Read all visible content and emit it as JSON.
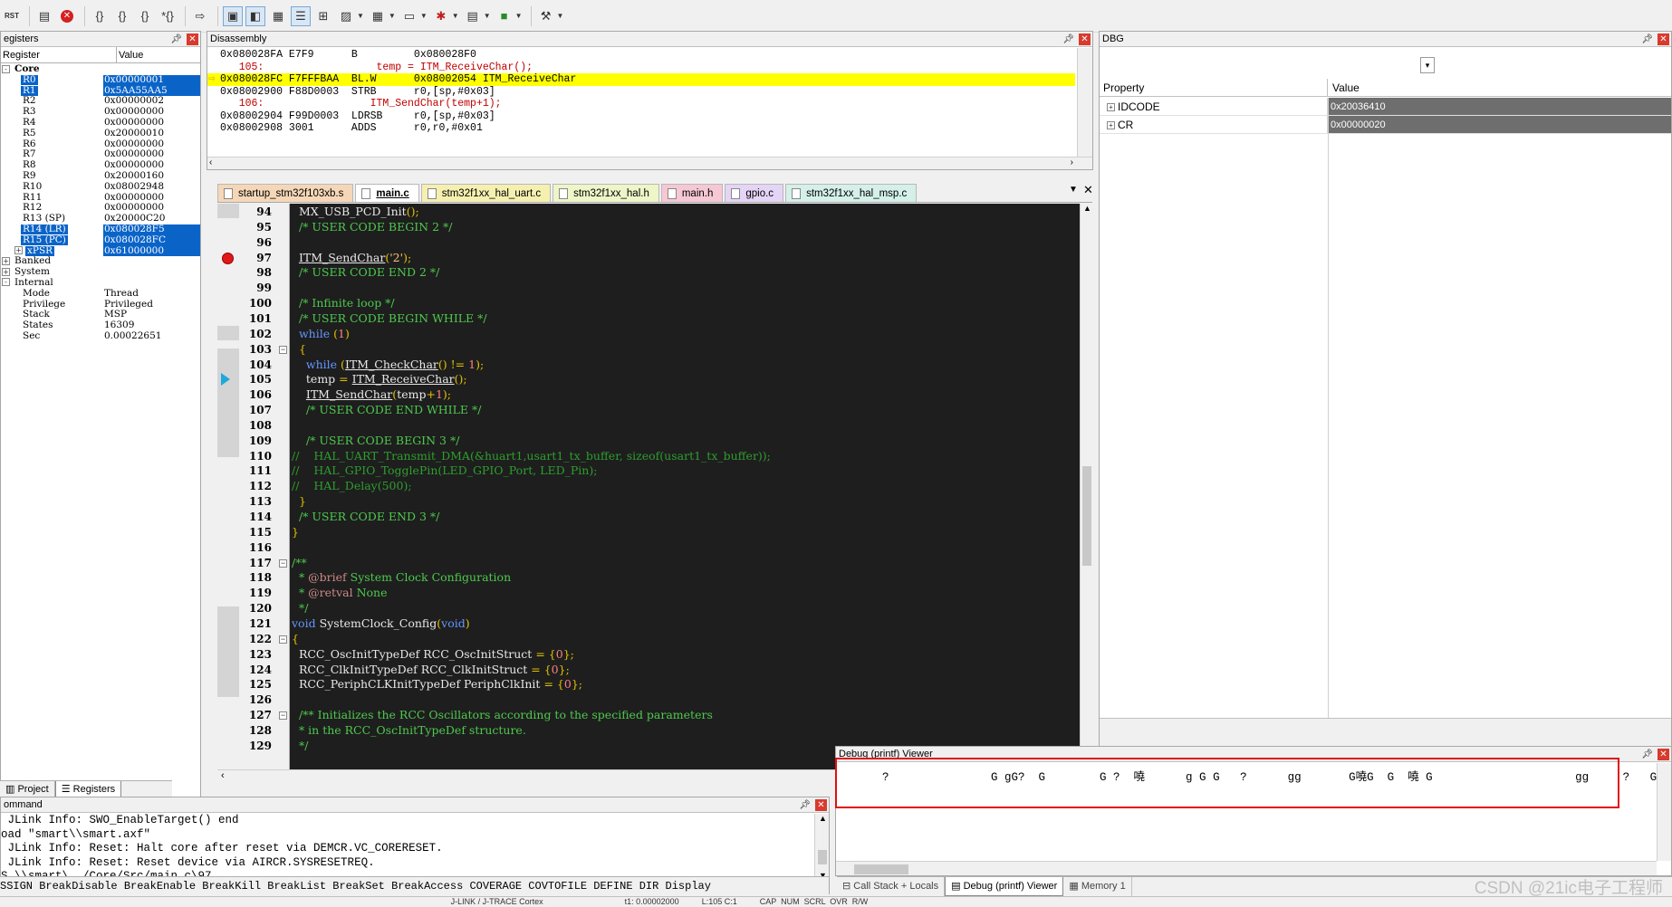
{
  "toolbar": {
    "reset_label": "RST",
    "icons": [
      "reset-icon",
      "doc-icon",
      "stop-icon",
      "step-into-icon",
      "step-over-icon",
      "step-out-icon",
      "run-to-cursor-icon",
      "show-next-icon",
      "command-window-icon",
      "disassembly-window-icon",
      "symbols-window-icon",
      "registers-window-icon",
      "call-stack-icon",
      "watch-window-icon",
      "memory-window-icon",
      "serial-window-icon",
      "analysis-window-icon",
      "trace-window-icon",
      "system-viewer-icon",
      "toolbox-icon"
    ]
  },
  "registers": {
    "title": "egisters",
    "col_register": "Register",
    "col_value": "Value",
    "rows": [
      {
        "name": "Core",
        "value": "",
        "indent": 0,
        "expander": "-",
        "bold": true,
        "sel": false
      },
      {
        "name": "R0",
        "value": "0x00000001",
        "indent": 2,
        "sel": true
      },
      {
        "name": "R1",
        "value": "0x5AA55AA5",
        "indent": 2,
        "sel": true
      },
      {
        "name": "R2",
        "value": "0x00000002",
        "indent": 2,
        "sel": false
      },
      {
        "name": "R3",
        "value": "0x00000000",
        "indent": 2,
        "sel": false
      },
      {
        "name": "R4",
        "value": "0x00000000",
        "indent": 2,
        "sel": false
      },
      {
        "name": "R5",
        "value": "0x20000010",
        "indent": 2,
        "sel": false
      },
      {
        "name": "R6",
        "value": "0x00000000",
        "indent": 2,
        "sel": false
      },
      {
        "name": "R7",
        "value": "0x00000000",
        "indent": 2,
        "sel": false
      },
      {
        "name": "R8",
        "value": "0x00000000",
        "indent": 2,
        "sel": false
      },
      {
        "name": "R9",
        "value": "0x20000160",
        "indent": 2,
        "sel": false
      },
      {
        "name": "R10",
        "value": "0x08002948",
        "indent": 2,
        "sel": false
      },
      {
        "name": "R11",
        "value": "0x00000000",
        "indent": 2,
        "sel": false
      },
      {
        "name": "R12",
        "value": "0x00000000",
        "indent": 2,
        "sel": false
      },
      {
        "name": "R13 (SP)",
        "value": "0x20000C20",
        "indent": 2,
        "sel": false
      },
      {
        "name": "R14 (LR)",
        "value": "0x080028F5",
        "indent": 2,
        "sel": true
      },
      {
        "name": "R15 (PC)",
        "value": "0x080028FC",
        "indent": 2,
        "sel": true
      },
      {
        "name": "xPSR",
        "value": "0x61000000",
        "indent": 2,
        "expander": "+",
        "sel": true
      },
      {
        "name": "Banked",
        "value": "",
        "indent": 0,
        "expander": "+",
        "sel": false
      },
      {
        "name": "System",
        "value": "",
        "indent": 0,
        "expander": "+",
        "sel": false
      },
      {
        "name": "Internal",
        "value": "",
        "indent": 0,
        "expander": "-",
        "sel": false
      },
      {
        "name": "Mode",
        "value": "Thread",
        "indent": 2,
        "sel": false
      },
      {
        "name": "Privilege",
        "value": "Privileged",
        "indent": 2,
        "sel": false
      },
      {
        "name": "Stack",
        "value": "MSP",
        "indent": 2,
        "sel": false
      },
      {
        "name": "States",
        "value": "16309",
        "indent": 2,
        "sel": false
      },
      {
        "name": "Sec",
        "value": "0.00022651",
        "indent": 2,
        "sel": false
      }
    ],
    "tabs": [
      "Project",
      "Registers"
    ]
  },
  "disassembly": {
    "title": "Disassembly",
    "rows": [
      {
        "text": "0x080028FA E7F9      B         0x080028F0",
        "kind": "asm"
      },
      {
        "text": "   105:                  temp = ITM_ReceiveChar();",
        "kind": "src"
      },
      {
        "text": "0x080028FC F7FFFBAA  BL.W      0x08002054 ITM_ReceiveChar",
        "kind": "cur"
      },
      {
        "text": "0x08002900 F88D0003  STRB      r0,[sp,#0x03]",
        "kind": "asm"
      },
      {
        "text": "   106:                 ITM_SendChar(temp+1);",
        "kind": "src"
      },
      {
        "text": "0x08002904 F99D0003  LDRSB     r0,[sp,#0x03]",
        "kind": "asm"
      },
      {
        "text": "0x08002908 3001      ADDS      r0,r0,#0x01",
        "kind": "asm"
      }
    ]
  },
  "editor_tabs": [
    {
      "label": "startup_stm32f103xb.s",
      "color": "#f5d7b8",
      "active": false
    },
    {
      "label": "main.c",
      "color": "#ffffff",
      "active": true
    },
    {
      "label": "stm32f1xx_hal_uart.c",
      "color": "#f5f0b0",
      "active": false
    },
    {
      "label": "stm32f1xx_hal.h",
      "color": "#eef5c8",
      "active": false
    },
    {
      "label": "main.h",
      "color": "#f5c8d4",
      "active": false
    },
    {
      "label": "gpio.c",
      "color": "#e4d4f5",
      "active": false
    },
    {
      "label": "stm32f1xx_hal_msp.c",
      "color": "#d4f0e8",
      "active": false
    }
  ],
  "code": {
    "lines": [
      {
        "n": "94",
        "html": "  MX_USB_PCD_Init<span class=\"punc\">();</span>"
      },
      {
        "n": "95",
        "html": "  <span class=\"cm\">/* USER CODE BEGIN 2 */</span>"
      },
      {
        "n": "96",
        "html": ""
      },
      {
        "n": "97",
        "html": "  <span class=\"fn\">ITM_SendChar</span><span class=\"punc\">(</span><span class=\"str\">'2'</span><span class=\"punc\">);</span>",
        "bp": true
      },
      {
        "n": "98",
        "html": "  <span class=\"cm\">/* USER CODE END 2 */</span>"
      },
      {
        "n": "99",
        "html": ""
      },
      {
        "n": "100",
        "html": "  <span class=\"cm\">/* Infinite loop */</span>"
      },
      {
        "n": "101",
        "html": "  <span class=\"cm\">/* USER CODE BEGIN WHILE */</span>"
      },
      {
        "n": "102",
        "html": "  <span class=\"kw\">while</span> <span class=\"punc\">(</span><span class=\"num\">1</span><span class=\"punc\">)</span>"
      },
      {
        "n": "103",
        "html": "  <span class=\"punc\">{</span>",
        "fold": true
      },
      {
        "n": "104",
        "html": "    <span class=\"kw\">while</span> <span class=\"punc\">(</span><span class=\"fn\">ITM_CheckChar</span><span class=\"punc\">()</span> <span class=\"punc\">!=</span> <span class=\"num\">1</span><span class=\"punc\">);</span>"
      },
      {
        "n": "105",
        "html": "    temp <span class=\"punc\">=</span> <span class=\"fn\">ITM_ReceiveChar</span><span class=\"punc\">();</span>",
        "cur": true
      },
      {
        "n": "106",
        "html": "    <span class=\"fn\">ITM_SendChar</span><span class=\"punc\">(</span>temp<span class=\"punc\">+</span><span class=\"num\">1</span><span class=\"punc\">);</span>"
      },
      {
        "n": "107",
        "html": "    <span class=\"cm\">/* USER CODE END WHILE */</span>"
      },
      {
        "n": "108",
        "html": ""
      },
      {
        "n": "109",
        "html": "    <span class=\"cm\">/* USER CODE BEGIN 3 */</span>"
      },
      {
        "n": "110",
        "html": "<span class=\"cmd\">//    HAL_UART_Transmit_DMA(&amp;huart1,usart1_tx_buffer, sizeof(usart1_tx_buffer));</span>"
      },
      {
        "n": "111",
        "html": "<span class=\"cmd\">//    HAL_GPIO_TogglePin(LED_GPIO_Port, LED_Pin);</span>"
      },
      {
        "n": "112",
        "html": "<span class=\"cmd\">//    HAL_Delay(500);</span>"
      },
      {
        "n": "113",
        "html": "  <span class=\"punc\">}</span>"
      },
      {
        "n": "114",
        "html": "  <span class=\"cm\">/* USER CODE END 3 */</span>"
      },
      {
        "n": "115",
        "html": "<span class=\"punc\">}</span>"
      },
      {
        "n": "116",
        "html": ""
      },
      {
        "n": "117",
        "html": "<span class=\"cm\">/**</span>",
        "fold": true
      },
      {
        "n": "118",
        "html": "<span class=\"cm\">  * <span class=\"tag\">@brief</span> System Clock Configuration</span>"
      },
      {
        "n": "119",
        "html": "<span class=\"cm\">  * <span class=\"tag\">@retval</span> None</span>"
      },
      {
        "n": "120",
        "html": "<span class=\"cm\">  */</span>"
      },
      {
        "n": "121",
        "html": "<span class=\"kw\">void</span> SystemClock_Config<span class=\"punc\">(</span><span class=\"kw\">void</span><span class=\"punc\">)</span>"
      },
      {
        "n": "122",
        "html": "<span class=\"punc\">{</span>",
        "fold": true
      },
      {
        "n": "123",
        "html": "  RCC_OscInitTypeDef RCC_OscInitStruct <span class=\"punc\">=</span> <span class=\"punc\">{</span><span class=\"num\">0</span><span class=\"punc\">};</span>"
      },
      {
        "n": "124",
        "html": "  RCC_ClkInitTypeDef RCC_ClkInitStruct <span class=\"punc\">=</span> <span class=\"punc\">{</span><span class=\"num\">0</span><span class=\"punc\">};</span>"
      },
      {
        "n": "125",
        "html": "  RCC_PeriphCLKInitTypeDef PeriphClkInit <span class=\"punc\">=</span> <span class=\"punc\">{</span><span class=\"num\">0</span><span class=\"punc\">};</span>"
      },
      {
        "n": "126",
        "html": ""
      },
      {
        "n": "127",
        "html": "  <span class=\"cm\">/** Initializes the RCC Oscillators according to the specified parameters</span>",
        "fold": true
      },
      {
        "n": "128",
        "html": "<span class=\"cm\">  * in the RCC_OscInitTypeDef structure.</span>"
      },
      {
        "n": "129",
        "html": "<span class=\"cm\">  */</span>"
      }
    ]
  },
  "dbg": {
    "title": "DBG",
    "col_property": "Property",
    "col_value": "Value",
    "rows": [
      {
        "name": "IDCODE",
        "value": "0x20036410"
      },
      {
        "name": "CR",
        "value": "0x00000020"
      }
    ]
  },
  "command": {
    "title": "ommand",
    "lines": [
      " JLink Info: SWO_EnableTarget() end",
      "oad \"smart\\\\smart.axf\"",
      " JLink Info: Reset: Halt core after reset via DEMCR.VC_CORERESET.",
      " JLink Info: Reset: Reset device via AIRCR.SYSRESETREQ.",
      "S \\\\smart\\../Core/Src/main.c\\97"
    ],
    "bar": "SSIGN BreakDisable BreakEnable BreakKill BreakList BreakSet BreakAccess COVERAGE COVTOFILE DEFINE DIR Display"
  },
  "printf": {
    "title": "Debug (printf) Viewer",
    "text": "      ?               G gG?  G        G ?  嘵      g G G   ?      gg       G嘵G  G  嘵 G                     gg     ?   G嘵    G      ?    gG??          ?",
    "tabs": [
      "Call Stack + Locals",
      "Debug (printf) Viewer",
      "Memory 1"
    ]
  },
  "statusbar": {
    "text": "                                                                                                                                                                                                       J-LINK / J-TRACE Cortex                                    t1: 0.00002000          L:105 C:1          CAP  NUM  SCRL  OVR  R/W"
  },
  "watermark": "CSDN @21ic电子工程师"
}
